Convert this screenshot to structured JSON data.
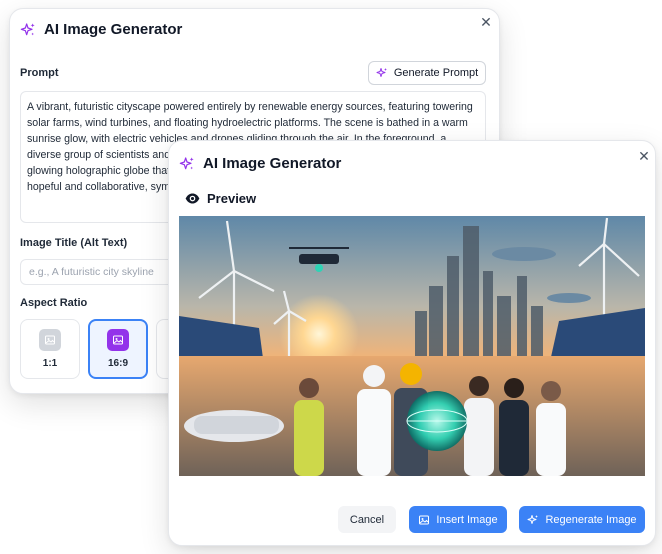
{
  "back_dialog": {
    "title": "AI Image Generator",
    "prompt_label": "Prompt",
    "generate_prompt_label": "Generate Prompt",
    "prompt_text": "A vibrant, futuristic cityscape powered entirely by renewable energy sources, featuring towering solar farms, wind turbines, and floating hydroelectric platforms. The scene is bathed in a warm sunrise glow, with electric vehicles and drones gliding through the air. In the foreground, a diverse group of scientists and engineers from different cultures stand together, holding a glowing holographic globe that displays interconnected energy networks. The atmosphere is hopeful and collaborative, symbolizing the integration of technology and nature.",
    "image_title_label": "Image Title (Alt Text)",
    "image_title_placeholder": "e.g., A futuristic city skyline",
    "image_title_value": "",
    "aspect_ratio_label": "Aspect Ratio",
    "aspect_ratios": [
      {
        "label": "1:1",
        "selected": false
      },
      {
        "label": "16:9",
        "selected": true
      }
    ]
  },
  "front_dialog": {
    "title": "AI Image Generator",
    "preview_label": "Preview",
    "cancel_label": "Cancel",
    "insert_label": "Insert Image",
    "regenerate_label": "Regenerate Image"
  },
  "colors": {
    "accent_purple": "#9333ea",
    "primary_blue": "#3b82f6",
    "selected_bg": "#eef4ff"
  },
  "icons": {
    "title": "sparkles-icon",
    "close": "close-icon",
    "generate": "sparkles-icon",
    "preview": "eye-icon",
    "ratio": "image-icon",
    "insert": "image-icon",
    "regenerate": "sparkles-icon"
  }
}
